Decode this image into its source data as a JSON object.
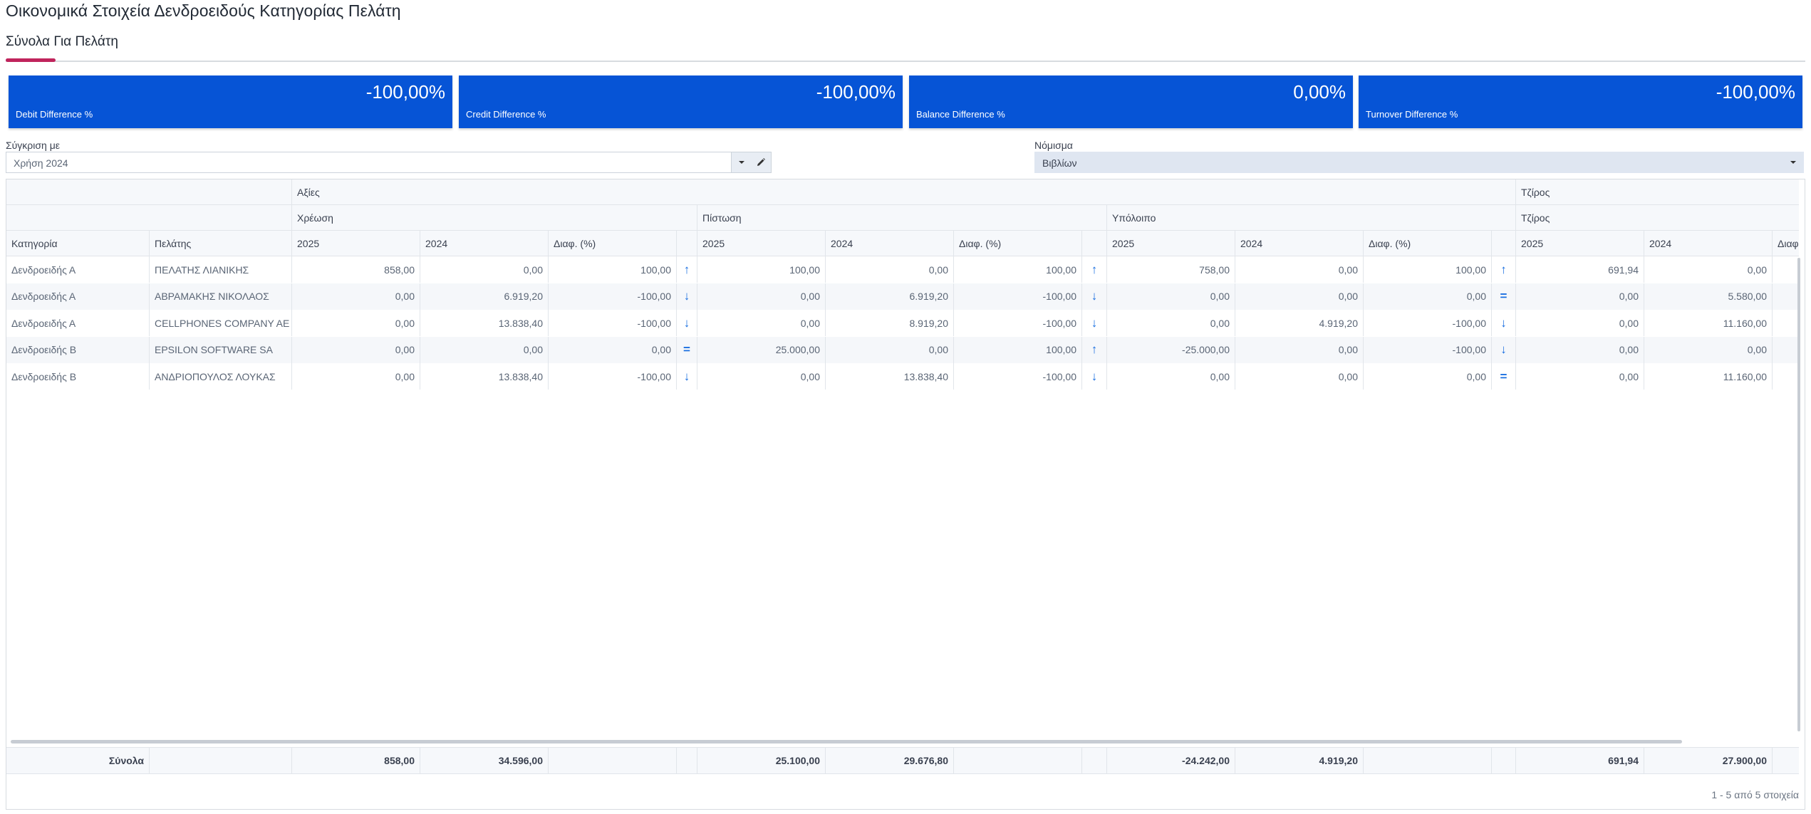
{
  "page": {
    "title": "Οικονομικά Στοιχεία Δενδροειδούς Κατηγορίας Πελάτη",
    "tab_label": "Σύνολα Για Πελάτη"
  },
  "kpis": [
    {
      "value": "-100,00%",
      "label": "Debit Difference %"
    },
    {
      "value": "-100,00%",
      "label": "Credit Difference %"
    },
    {
      "value": "0,00%",
      "label": "Balance Difference %"
    },
    {
      "value": "-100,00%",
      "label": "Turnover Difference %"
    }
  ],
  "filters": {
    "compare_label": "Σύγκριση με",
    "compare_value": "Χρήση 2024",
    "currency_label": "Νόμισμα",
    "currency_value": "Βιβλίων"
  },
  "grid": {
    "band_header": {
      "values": "Αξίες",
      "turnover": "Τζίρος"
    },
    "group_header": {
      "debit": "Χρέωση",
      "credit": "Πίστωση",
      "balance": "Υπόλοιπο",
      "turnover": "Τζίρος"
    },
    "columns": {
      "category": "Κατηγορία",
      "customer": "Πελάτης",
      "y2025": "2025",
      "y2024": "2024",
      "diff": "Διαφ. (%)",
      "diff_cut": "Διαφ"
    },
    "rows": [
      {
        "category": "Δενδροειδής Α",
        "customer": "ΠΕΛΑΤΗΣ ΛΙΑΝΙΚΗΣ",
        "d25": "858,00",
        "d24": "0,00",
        "dd": "100,00",
        "da": "↑",
        "c25": "100,00",
        "c24": "0,00",
        "cd": "100,00",
        "ca": "↑",
        "b25": "758,00",
        "b24": "0,00",
        "bd": "100,00",
        "ba": "↑",
        "t25": "691,94",
        "t24": "0,00"
      },
      {
        "category": "Δενδροειδής Α",
        "customer": "ΑΒΡΑΜΑΚΗΣ ΝΙΚΟΛΑΟΣ",
        "d25": "0,00",
        "d24": "6.919,20",
        "dd": "-100,00",
        "da": "↓",
        "c25": "0,00",
        "c24": "6.919,20",
        "cd": "-100,00",
        "ca": "↓",
        "b25": "0,00",
        "b24": "0,00",
        "bd": "0,00",
        "ba": "=",
        "t25": "0,00",
        "t24": "5.580,00"
      },
      {
        "category": "Δενδροειδής Α",
        "customer": "CELLPHONES COMPANY AE",
        "d25": "0,00",
        "d24": "13.838,40",
        "dd": "-100,00",
        "da": "↓",
        "c25": "0,00",
        "c24": "8.919,20",
        "cd": "-100,00",
        "ca": "↓",
        "b25": "0,00",
        "b24": "4.919,20",
        "bd": "-100,00",
        "ba": "↓",
        "t25": "0,00",
        "t24": "11.160,00"
      },
      {
        "category": "Δενδροειδής Β",
        "customer": "EPSILON SOFTWARE SA",
        "d25": "0,00",
        "d24": "0,00",
        "dd": "0,00",
        "da": "=",
        "c25": "25.000,00",
        "c24": "0,00",
        "cd": "100,00",
        "ca": "↑",
        "b25": "-25.000,00",
        "b24": "0,00",
        "bd": "-100,00",
        "ba": "↓",
        "t25": "0,00",
        "t24": "0,00"
      },
      {
        "category": "Δενδροειδής Β",
        "customer": "ΑΝΔΡΙΟΠΟΥΛΟΣ ΛΟΥΚΑΣ",
        "d25": "0,00",
        "d24": "13.838,40",
        "dd": "-100,00",
        "da": "↓",
        "c25": "0,00",
        "c24": "13.838,40",
        "cd": "-100,00",
        "ca": "↓",
        "b25": "0,00",
        "b24": "0,00",
        "bd": "0,00",
        "ba": "=",
        "t25": "0,00",
        "t24": "11.160,00"
      }
    ],
    "totals": {
      "label": "Σύνολα",
      "d25": "858,00",
      "d24": "34.596,00",
      "c25": "25.100,00",
      "c24": "29.676,80",
      "b25": "-24.242,00",
      "b24": "4.919,20",
      "t25": "691,94",
      "t24": "27.900,00"
    },
    "pager_text": "1 - 5 από 5 στοιχεία"
  },
  "colors": {
    "kpi_background": "#0654d6",
    "tab_underline": "#c0245c",
    "trend_arrow": "#1a6fe0"
  }
}
